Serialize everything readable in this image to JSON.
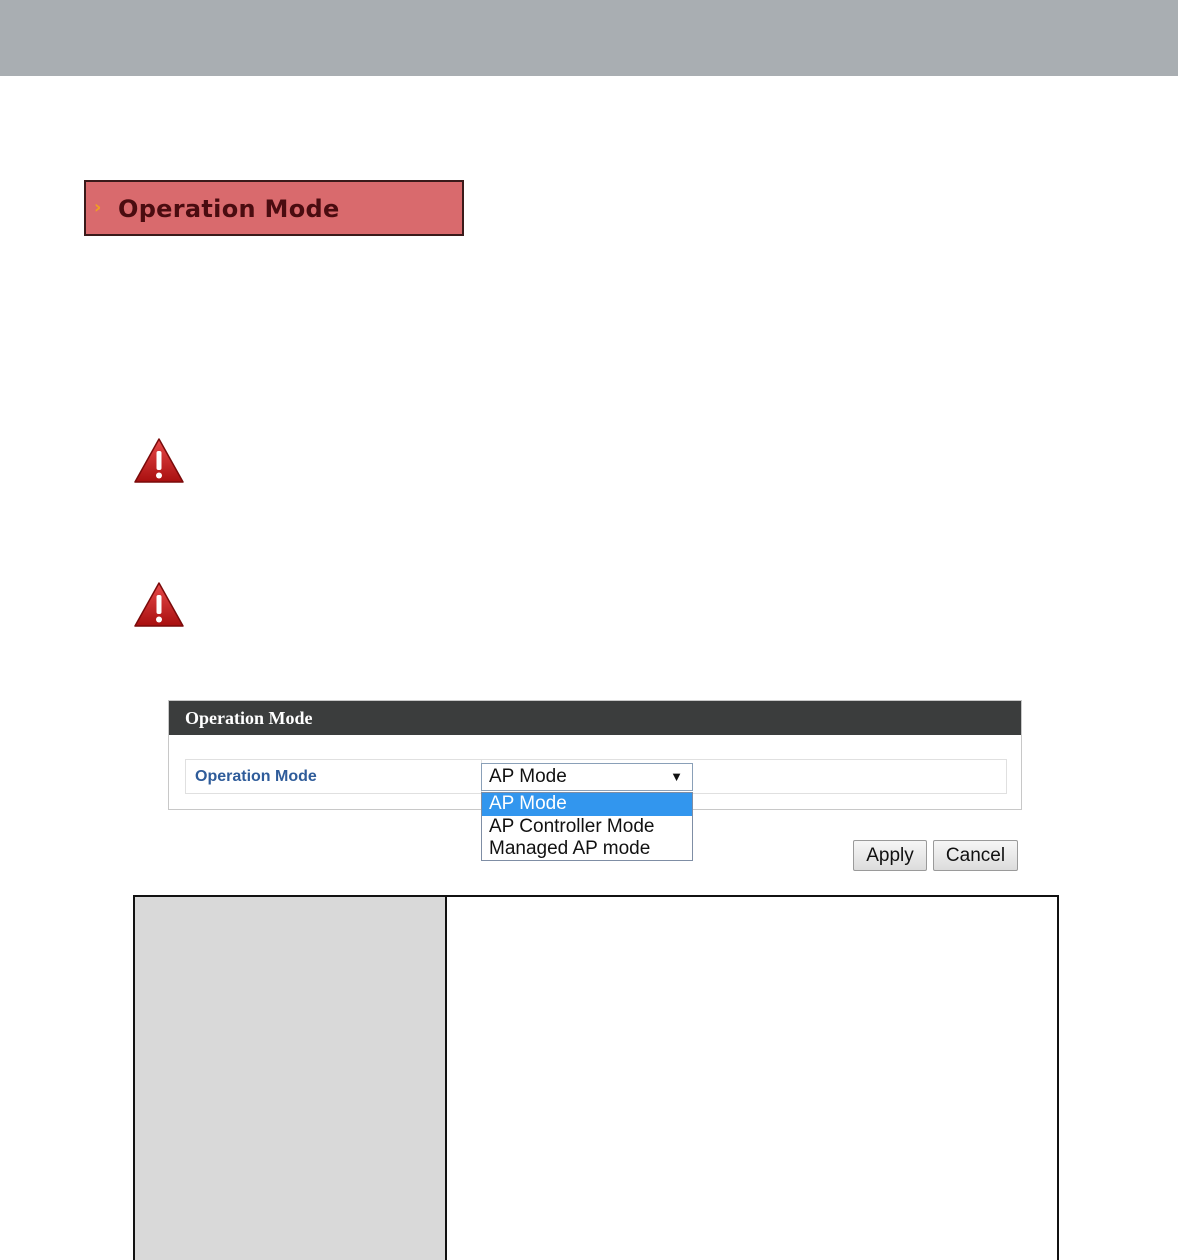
{
  "section": {
    "chevron": "›",
    "title": "Operation Mode"
  },
  "warnings": [
    {
      "icon": "warning-triangle-icon"
    },
    {
      "icon": "warning-triangle-icon"
    }
  ],
  "panel": {
    "header": "Operation Mode",
    "field_label": "Operation Mode",
    "select": {
      "value": "AP Mode",
      "arrow": "▼",
      "options": [
        "AP Mode",
        "AP Controller Mode",
        "Managed AP mode"
      ],
      "highlighted_index": 0
    }
  },
  "buttons": {
    "apply": "Apply",
    "cancel": "Cancel"
  },
  "colors": {
    "top_band": "#a9aeb2",
    "section_banner": "#d96a6d",
    "panel_header": "#3b3d3d",
    "label_blue": "#2f5c9a",
    "option_highlight": "#3296ee",
    "warning_red": "#c41a1a"
  }
}
